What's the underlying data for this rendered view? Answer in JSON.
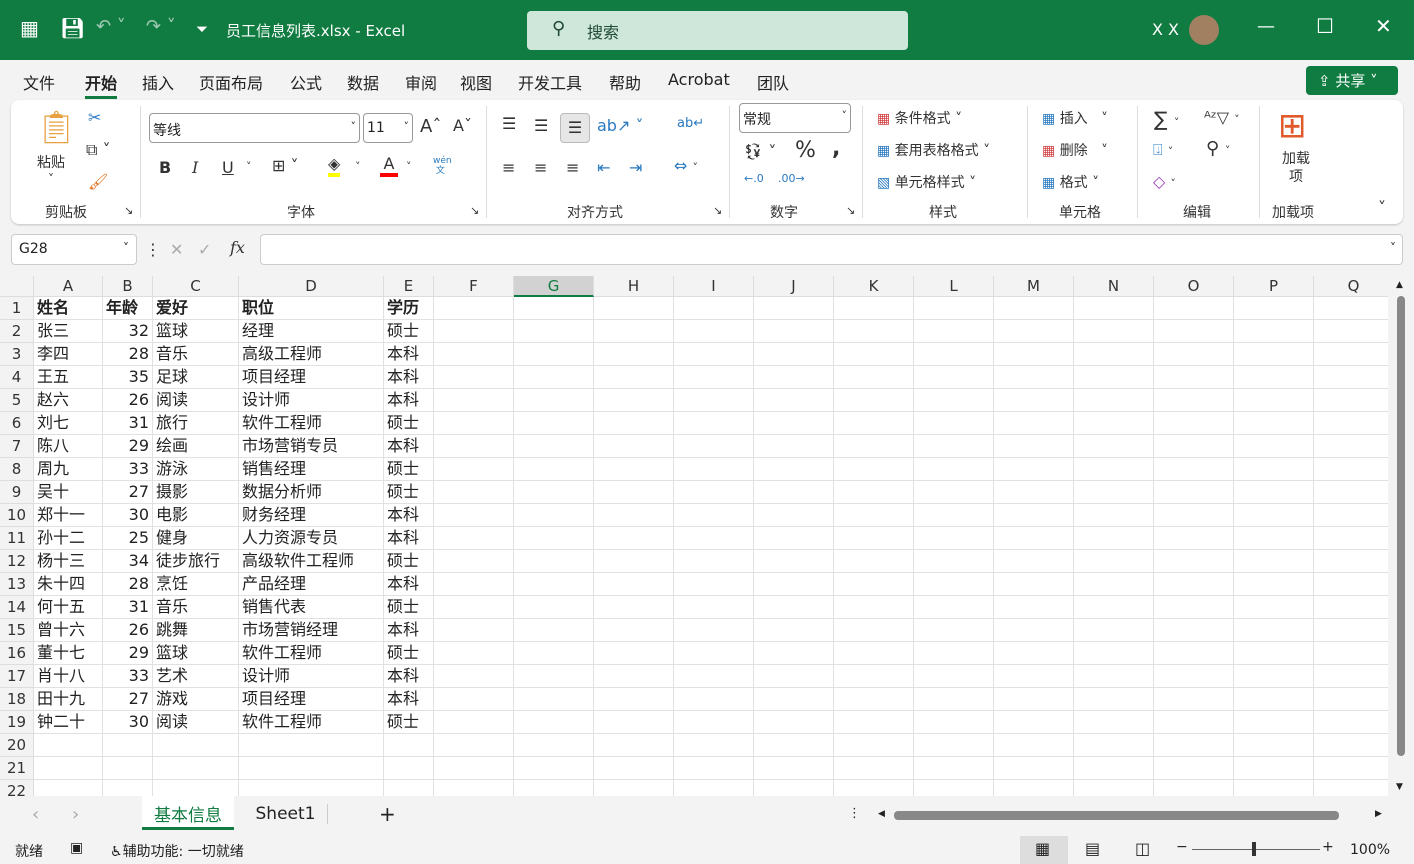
{
  "title_bar": {
    "file_title": "员工信息列表.xlsx  -  Excel",
    "search_placeholder": "搜索",
    "user": "X X"
  },
  "menu": {
    "tabs": [
      "文件",
      "开始",
      "插入",
      "页面布局",
      "公式",
      "数据",
      "审阅",
      "视图",
      "开发工具",
      "帮助",
      "Acrobat",
      "团队"
    ],
    "active": "开始",
    "share": "共享"
  },
  "ribbon": {
    "clipboard": {
      "paste": "粘贴",
      "label": "剪贴板"
    },
    "font": {
      "name": "等线",
      "size": "11",
      "bold": "B",
      "italic": "I",
      "underline": "U",
      "label": "字体",
      "phonetic": "wén"
    },
    "alignment": {
      "label": "对齐方式"
    },
    "number": {
      "format": "常规",
      "label": "数字"
    },
    "styles": {
      "conditional": "条件格式",
      "table": "套用表格格式",
      "cell": "单元格样式",
      "label": "样式"
    },
    "cells": {
      "insert": "插入",
      "delete": "删除",
      "format": "格式",
      "label": "单元格"
    },
    "editing": {
      "label": "编辑"
    },
    "addins": {
      "button": "加载项",
      "label": "加载项"
    }
  },
  "formula_bar": {
    "name_box": "G28",
    "fx": "fx",
    "value": ""
  },
  "sheet": {
    "columns": [
      "A",
      "B",
      "C",
      "D",
      "E",
      "F",
      "G",
      "H",
      "I",
      "J",
      "K",
      "L",
      "M",
      "N",
      "O",
      "P",
      "Q"
    ],
    "selected_column": "G",
    "row_numbers": [
      "1",
      "2",
      "3",
      "4",
      "5",
      "6",
      "7",
      "8",
      "9",
      "10",
      "11",
      "12",
      "13",
      "14",
      "15",
      "16",
      "17",
      "18",
      "19",
      "20",
      "21",
      "22"
    ],
    "headers": [
      "姓名",
      "年龄",
      "爱好",
      "职位",
      "学历"
    ],
    "rows": [
      [
        "张三",
        "32",
        "篮球",
        "经理",
        "硕士"
      ],
      [
        "李四",
        "28",
        "音乐",
        "高级工程师",
        "本科"
      ],
      [
        "王五",
        "35",
        "足球",
        "项目经理",
        "本科"
      ],
      [
        "赵六",
        "26",
        "阅读",
        "设计师",
        "本科"
      ],
      [
        "刘七",
        "31",
        "旅行",
        "软件工程师",
        "硕士"
      ],
      [
        "陈八",
        "29",
        "绘画",
        "市场营销专员",
        "本科"
      ],
      [
        "周九",
        "33",
        "游泳",
        "销售经理",
        "硕士"
      ],
      [
        "吴十",
        "27",
        "摄影",
        "数据分析师",
        "硕士"
      ],
      [
        "郑十一",
        "30",
        "电影",
        "财务经理",
        "本科"
      ],
      [
        "孙十二",
        "25",
        "健身",
        "人力资源专员",
        "本科"
      ],
      [
        "杨十三",
        "34",
        "徒步旅行",
        "高级软件工程师",
        "硕士"
      ],
      [
        "朱十四",
        "28",
        "烹饪",
        "产品经理",
        "本科"
      ],
      [
        "何十五",
        "31",
        "音乐",
        "销售代表",
        "硕士"
      ],
      [
        "曾十六",
        "26",
        "跳舞",
        "市场营销经理",
        "本科"
      ],
      [
        "董十七",
        "29",
        "篮球",
        "软件工程师",
        "硕士"
      ],
      [
        "肖十八",
        "33",
        "艺术",
        "设计师",
        "本科"
      ],
      [
        "田十九",
        "27",
        "游戏",
        "项目经理",
        "本科"
      ],
      [
        "钟二十",
        "30",
        "阅读",
        "软件工程师",
        "硕士"
      ]
    ]
  },
  "sheet_tabs": [
    "基本信息",
    "Sheet1"
  ],
  "active_sheet": "基本信息",
  "status": {
    "ready": "就绪",
    "accessibility": "辅助功能: 一切就绪",
    "zoom": "100%"
  }
}
